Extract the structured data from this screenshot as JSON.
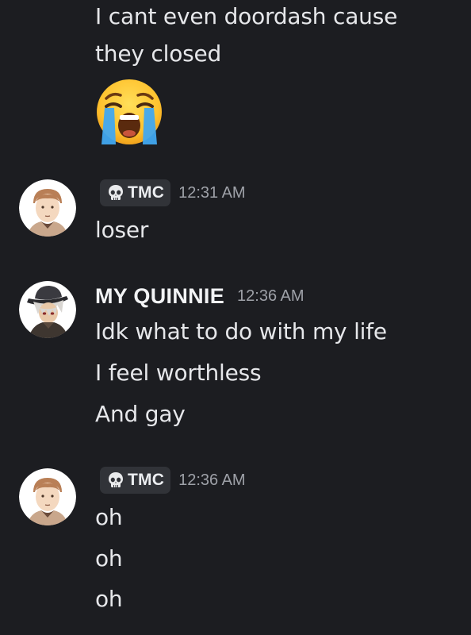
{
  "messages": {
    "prev": {
      "lines": [
        "I cant even doordash cause",
        "they closed"
      ],
      "emoji_icon": "loudly-crying-face-icon"
    },
    "tmc_1": {
      "tag": "TMC",
      "tag_icon": "skull-icon",
      "time": "12:31 AM",
      "lines": [
        "loser"
      ]
    },
    "quinnie": {
      "username": "MY QUINNIE",
      "time": "12:36 AM",
      "lines": [
        "Idk what to do with my life",
        "I feel worthless",
        "And gay"
      ]
    },
    "tmc_2": {
      "tag": "TMC",
      "tag_icon": "skull-icon",
      "time": "12:36 AM",
      "lines": [
        "oh",
        "oh",
        "oh"
      ]
    }
  },
  "colors": {
    "background": "#1c1d21",
    "text": "#e6e7ea",
    "timestamp": "#9ea1a8",
    "tag_background": "#313338",
    "emoji_face": "#ffcb3d",
    "tears": "#41a8f0"
  }
}
